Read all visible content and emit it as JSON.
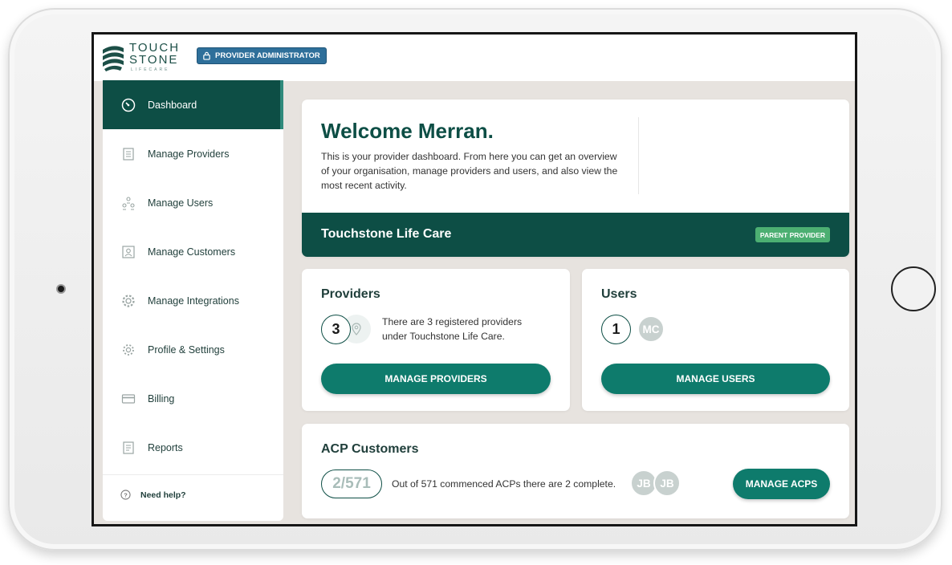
{
  "brand": {
    "logo_line1": "TOUCH",
    "logo_line2": "STONE",
    "logo_sub": "LIFECARE"
  },
  "header": {
    "role_badge": "PROVIDER ADMINISTRATOR"
  },
  "sidebar": {
    "items": [
      {
        "label": "Dashboard",
        "icon": "dashboard-icon",
        "active": true
      },
      {
        "label": "Manage Providers",
        "icon": "document-list-icon"
      },
      {
        "label": "Manage Users",
        "icon": "users-hierarchy-icon"
      },
      {
        "label": "Manage Customers",
        "icon": "customer-card-icon"
      },
      {
        "label": "Manage Integrations",
        "icon": "integrations-gear-icon"
      },
      {
        "label": "Profile & Settings",
        "icon": "settings-gear-icon"
      },
      {
        "label": "Billing",
        "icon": "billing-card-icon"
      },
      {
        "label": "Reports",
        "icon": "reports-icon"
      }
    ],
    "help_label": "Need help?"
  },
  "welcome": {
    "title": "Welcome Merran.",
    "text": "This is your provider dashboard. From here you can get an overview of your organisation, manage providers and users, and also view the most recent activity.",
    "org_name": "Touchstone Life Care",
    "org_badge": "PARENT PROVIDER"
  },
  "providers": {
    "title": "Providers",
    "count": "3",
    "description_line1": "There are 3 registered providers",
    "description_line2": "under Touchstone Life Care.",
    "button": "MANAGE PROVIDERS"
  },
  "users": {
    "title": "Users",
    "count": "1",
    "avatars": [
      "MC"
    ],
    "button": "MANAGE USERS"
  },
  "acp": {
    "title": "ACP Customers",
    "ratio": "2/571",
    "description": "Out of 571 commenced ACPs there are 2 complete.",
    "avatars": [
      "JB",
      "JB"
    ],
    "button": "MANAGE ACPS"
  },
  "colors": {
    "primary_dark": "#0d4e45",
    "button_teal": "#0e7b6c",
    "badge_blue": "#2e6f9a",
    "badge_green": "#4caf72"
  }
}
